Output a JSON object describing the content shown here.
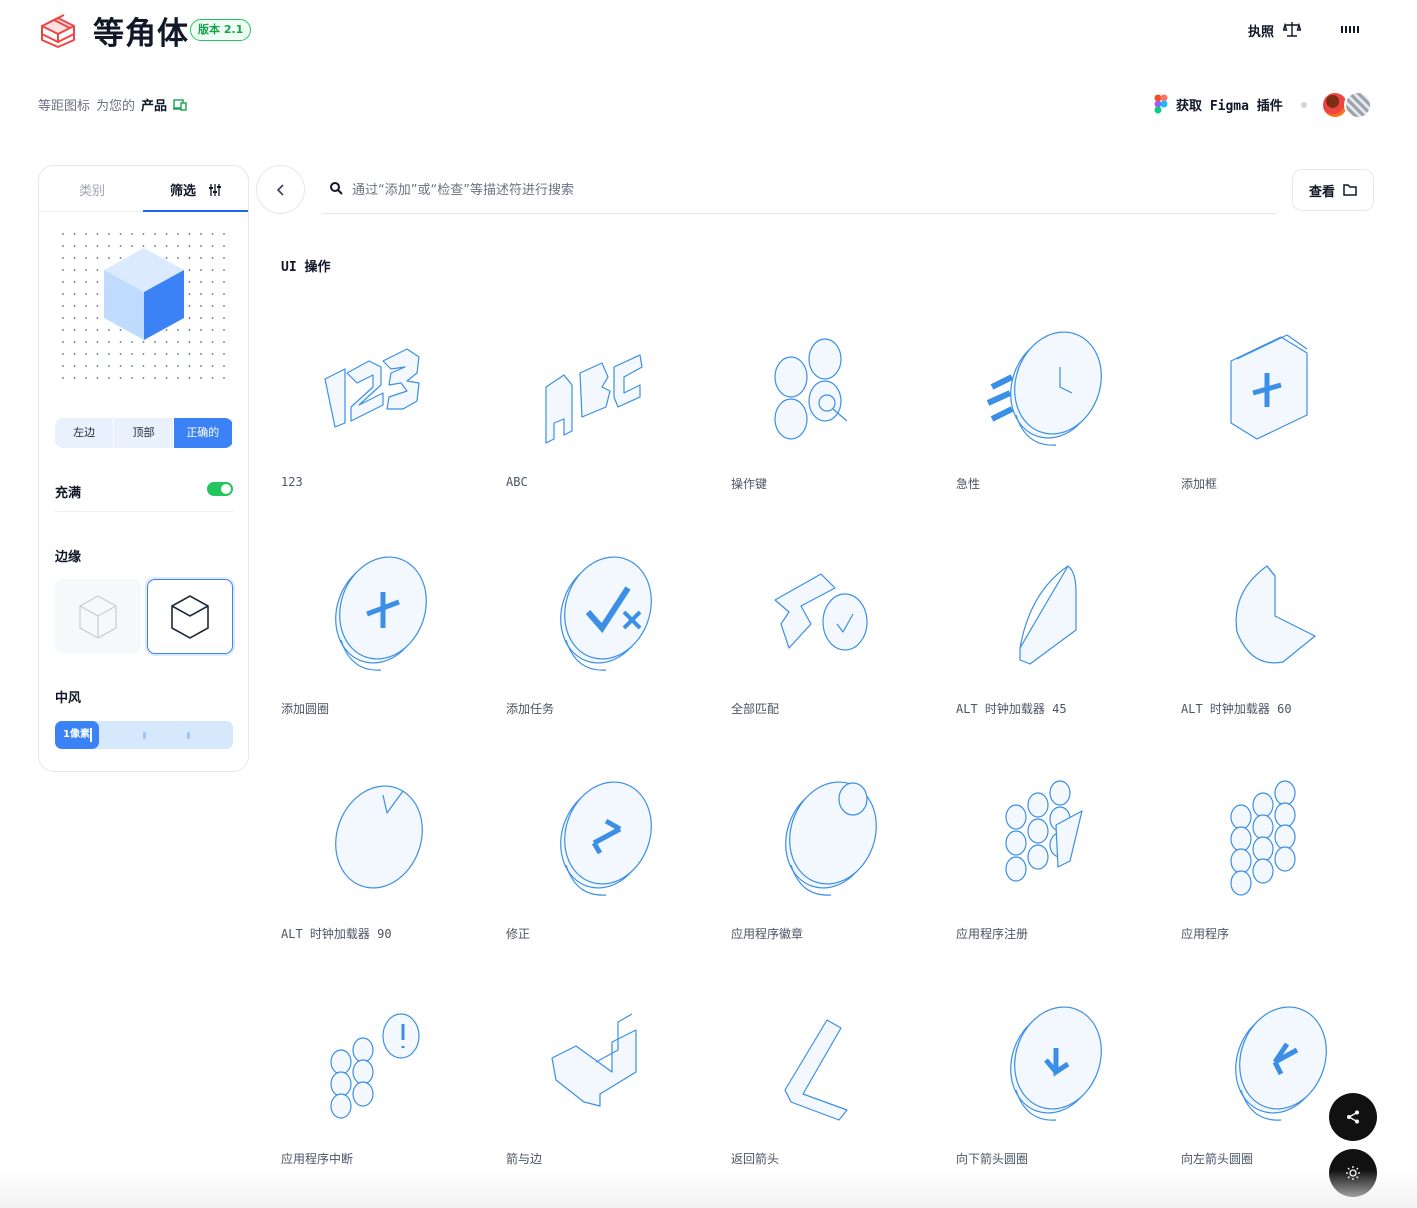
{
  "header": {
    "brand": "等角体",
    "version": "版本 2.1",
    "license_link": "执照",
    "tagline_part1": "等距图标",
    "tagline_part2": "为您的",
    "tagline_part3": "产品",
    "figma_link": "获取 Figma 插件"
  },
  "sidebar": {
    "tab_categories": "类别",
    "tab_filter": "筛选",
    "view_options": [
      "左边",
      "顶部",
      "正确的"
    ],
    "view_selected": "正确的",
    "fill_label": "充满",
    "fill_on": true,
    "edge_label": "边缘",
    "stroke_label": "中风",
    "stroke_value": "1像素"
  },
  "search": {
    "placeholder": "通过“添加”或“检查”等描述符进行搜索"
  },
  "view_button": "查看",
  "section_title": "UI 操作",
  "icons": [
    {
      "label": "123",
      "icon": "numbers-icon"
    },
    {
      "label": "ABC",
      "icon": "letters-icon"
    },
    {
      "label": "操作键",
      "icon": "command-key-icon"
    },
    {
      "label": "急性",
      "icon": "urgent-clock-icon"
    },
    {
      "label": "添加框",
      "icon": "add-box-icon"
    },
    {
      "label": "添加圆圈",
      "icon": "add-circle-icon"
    },
    {
      "label": "添加任务",
      "icon": "add-task-icon"
    },
    {
      "label": "全部匹配",
      "icon": "match-all-icon"
    },
    {
      "label": "ALT 时钟加载器 45",
      "icon": "clock-loader-45-icon"
    },
    {
      "label": "ALT 时钟加载器 60",
      "icon": "clock-loader-60-icon"
    },
    {
      "label": "ALT 时钟加载器 90",
      "icon": "clock-loader-90-icon"
    },
    {
      "label": "修正",
      "icon": "amend-icon"
    },
    {
      "label": "应用程序徽章",
      "icon": "app-badge-icon"
    },
    {
      "label": "应用程序注册",
      "icon": "app-registration-icon"
    },
    {
      "label": "应用程序",
      "icon": "apps-icon"
    },
    {
      "label": "应用程序中断",
      "icon": "apps-outage-icon"
    },
    {
      "label": "箭与边",
      "icon": "arrow-and-edge-icon"
    },
    {
      "label": "返回箭头",
      "icon": "arrow-back-icon"
    },
    {
      "label": "向下箭头圆圈",
      "icon": "arrow-down-circle-icon"
    },
    {
      "label": "向左箭头圆圈",
      "icon": "arrow-left-circle-icon"
    }
  ],
  "colors": {
    "accent": "#3b82f6",
    "green": "#22c55e",
    "icon_stroke": "#3b8fe6",
    "icon_fill": "#f3f8fe"
  }
}
